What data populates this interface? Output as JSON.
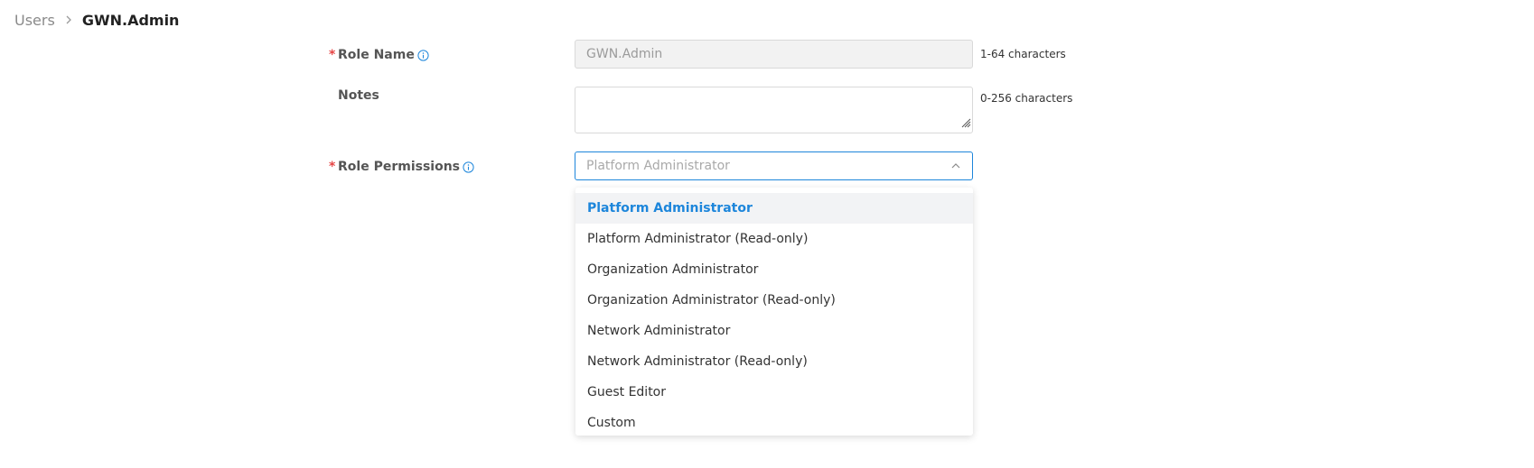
{
  "breadcrumb": {
    "parent": "Users",
    "current": "GWN.Admin"
  },
  "form": {
    "role_name": {
      "label": "Role Name",
      "value": "GWN.Admin",
      "hint": "1-64 characters"
    },
    "notes": {
      "label": "Notes",
      "value": "",
      "hint": "0-256 characters"
    },
    "role_permissions": {
      "label": "Role Permissions",
      "placeholder": "Platform Administrator",
      "options": [
        "Platform Administrator",
        "Platform Administrator (Read-only)",
        "Organization Administrator",
        "Organization Administrator (Read-only)",
        "Network Administrator",
        "Network Administrator (Read-only)",
        "Guest Editor",
        "Custom"
      ]
    }
  },
  "colors": {
    "accent": "#1d86db",
    "required": "#e64545",
    "selected_bg": "#f2f3f5"
  },
  "icons": {
    "breadcrumb_separator": "chevron-right-icon",
    "info": "info-icon",
    "dropdown": "chevron-up-icon"
  }
}
